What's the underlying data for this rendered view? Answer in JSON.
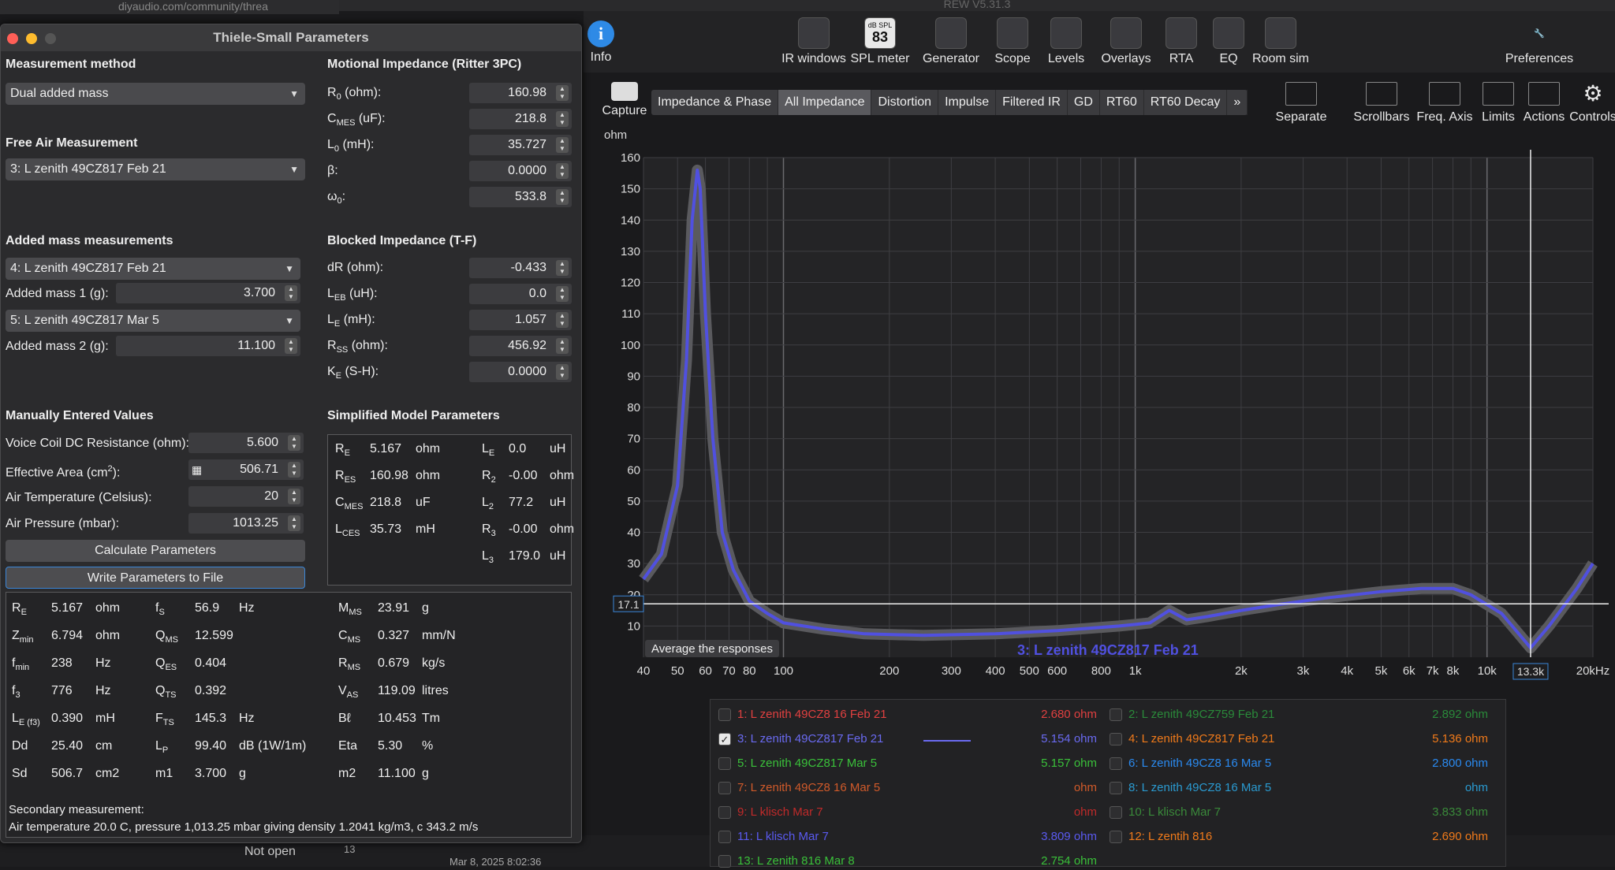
{
  "rew": {
    "app_title": "REW V5.31.3",
    "browser_url": "diyaudio.com/community/threa",
    "toolbar": [
      {
        "label": "IR windows",
        "icon": "ir-windows-icon",
        "x": 1032
      },
      {
        "label": "SPL meter",
        "icon": "spl-meter-icon",
        "x": 1116,
        "badge_top": "dB SPL",
        "badge": "83"
      },
      {
        "label": "Generator",
        "icon": "generator-icon",
        "x": 1206
      },
      {
        "label": "Scope",
        "icon": "scope-icon",
        "x": 1284
      },
      {
        "label": "Levels",
        "icon": "levels-icon",
        "x": 1352
      },
      {
        "label": "Overlays",
        "icon": "overlays-icon",
        "x": 1428
      },
      {
        "label": "RTA",
        "icon": "rta-icon",
        "x": 1498
      },
      {
        "label": "EQ",
        "icon": "eq-icon",
        "x": 1558
      },
      {
        "label": "Room sim",
        "icon": "room-sim-icon",
        "x": 1624
      },
      {
        "label": "Preferences",
        "icon": "preferences-icon",
        "x": 1952
      }
    ],
    "info_label": "Info",
    "capture_label": "Capture",
    "tabs": [
      "Impedance & Phase",
      "All Impedance",
      "Distortion",
      "Impulse",
      "Filtered IR",
      "GD",
      "RT60",
      "RT60 Decay",
      "»"
    ],
    "active_tab": 1,
    "graph_tools": [
      "Separate",
      "Scrollbars",
      "Freq. Axis",
      "Limits",
      "Actions",
      "Controls"
    ],
    "graph": {
      "y_unit": "ohm",
      "cursor_value": "17.1",
      "cursor_freq": "13.3k",
      "overlay_label": "3: L zenith 49CZ817 Feb 21",
      "average_button": "Average the responses"
    }
  },
  "chart_data": {
    "type": "line",
    "ylabel": "ohm",
    "xscale": "log",
    "xlim": [
      40,
      20000
    ],
    "ylim": [
      0,
      160
    ],
    "y_ticks": [
      10,
      20,
      30,
      40,
      50,
      60,
      70,
      80,
      90,
      100,
      110,
      120,
      130,
      140,
      150,
      160
    ],
    "x_ticks": [
      "40",
      "50",
      "60",
      "70",
      "80",
      "100",
      "200",
      "300",
      "400",
      "500",
      "600",
      "800",
      "1k",
      "2k",
      "3k",
      "4k",
      "5k",
      "6k",
      "7k",
      "8k",
      "10k",
      "13.3k",
      "20kHz"
    ],
    "x_tick_values": [
      40,
      50,
      60,
      70,
      80,
      100,
      200,
      300,
      400,
      500,
      600,
      800,
      1000,
      2000,
      3000,
      4000,
      5000,
      6000,
      7000,
      8000,
      10000,
      13300,
      20000
    ],
    "series": [
      {
        "name": "3: L zenith 49CZ817 Feb 21",
        "color": "#5050e0",
        "x": [
          40,
          45,
          50,
          53,
          55,
          56.9,
          58,
          60,
          63,
          67,
          72,
          80,
          90,
          100,
          130,
          170,
          250,
          400,
          600,
          900,
          1000,
          1100,
          1250,
          1400,
          1600,
          2000,
          2600,
          3500,
          5000,
          6500,
          8000,
          9000,
          11000,
          13300,
          15000,
          18000,
          20000
        ],
        "y": [
          25,
          33,
          55,
          95,
          140,
          156,
          150,
          110,
          70,
          40,
          28,
          18,
          14,
          11,
          9,
          7.5,
          7,
          7.5,
          8.5,
          10,
          10.5,
          11,
          15,
          12,
          13,
          15,
          17,
          19,
          21,
          22,
          22,
          20,
          14,
          3,
          10,
          22,
          30
        ]
      }
    ]
  },
  "legend": [
    {
      "label": "1: L zenith 49CZ8 16 Feb 21",
      "value": "2.680 ohm",
      "color": "#e04040",
      "checked": false
    },
    {
      "label": "2: L zenith 49CZ759 Feb 21",
      "value": "2.892 ohm",
      "color": "#2a8a3a",
      "checked": false
    },
    {
      "label": "3: L zenith 49CZ817 Feb 21",
      "value": "5.154 ohm",
      "color": "#6a6af0",
      "checked": true
    },
    {
      "label": "4: L zenith 49CZ817 Feb 21",
      "value": "5.136 ohm",
      "color": "#f07a1a",
      "checked": false
    },
    {
      "label": "5: L zenith 49CZ817 Mar 5",
      "value": "5.157 ohm",
      "color": "#3ac03a",
      "checked": false
    },
    {
      "label": "6: L zenith 49CZ8 16 Mar 5",
      "value": "2.800 ohm",
      "color": "#2a8af0",
      "checked": false
    },
    {
      "label": "7: L zenith 49CZ8 16 Mar 5",
      "value": "ohm",
      "color": "#d05a2a",
      "checked": false
    },
    {
      "label": "8: L zenith 49CZ8 16 Mar 5",
      "value": "ohm",
      "color": "#2a9ad0",
      "checked": false
    },
    {
      "label": "9: L klisch Mar 7",
      "value": "ohm",
      "color": "#c02a2a",
      "checked": false
    },
    {
      "label": "10: L klisch Mar 7",
      "value": "3.833 ohm",
      "color": "#3a8a3a",
      "checked": false
    },
    {
      "label": "11: L klisch Mar 7",
      "value": "3.809 ohm",
      "color": "#5a5af0",
      "checked": false
    },
    {
      "label": "12: L zentih 816",
      "value": "2.690 ohm",
      "color": "#f07a1a",
      "checked": false
    },
    {
      "label": "13: L zenith 816  Mar 8",
      "value": "2.754 ohm",
      "color": "#3ac03a",
      "checked": false
    }
  ],
  "ts": {
    "title": "Thiele-Small Parameters",
    "measurement_method_heading": "Measurement method",
    "measurement_method": "Dual added mass",
    "free_air_heading": "Free Air Measurement",
    "free_air": "3: L zenith 49CZ817 Feb 21",
    "added_mass_heading": "Added mass measurements",
    "added_mass_sel1": "4: L zenith 49CZ817 Feb 21",
    "added_mass1_label": "Added mass 1 (g):",
    "added_mass1": "3.700",
    "added_mass_sel2": "5: L zenith 49CZ817 Mar 5",
    "added_mass2_label": "Added mass 2 (g):",
    "added_mass2": "11.100",
    "manual_heading": "Manually Entered Values",
    "vc_label": "Voice Coil DC Resistance (ohm):",
    "vc": "5.600",
    "area_label": "Effective Area (cm",
    "area": "506.71",
    "temp_label": "Air Temperature (Celsius):",
    "temp": "20",
    "pressure_label": "Air Pressure (mbar):",
    "pressure": "1013.25",
    "calc_button": "Calculate Parameters",
    "write_button": "Write Parameters to File",
    "motional_heading": "Motional Impedance (Ritter 3PC)",
    "motional": [
      {
        "sym": "R",
        "sub": "0",
        "unit": " (ohm):",
        "val": "160.98"
      },
      {
        "sym": "C",
        "sub": "MES",
        "unit": " (uF):",
        "val": "218.8"
      },
      {
        "sym": "L",
        "sub": "0",
        "unit": " (mH):",
        "val": "35.727"
      },
      {
        "sym": "β:",
        "sub": "",
        "unit": "",
        "val": "0.0000"
      },
      {
        "sym": "ω",
        "sub": "0",
        "unit": ":",
        "val": "533.8"
      }
    ],
    "blocked_heading": "Blocked Impedance (T-F)",
    "blocked": [
      {
        "sym": "dR (ohm):",
        "sub": "",
        "unit": "",
        "val": "-0.433"
      },
      {
        "sym": "L",
        "sub": "EB",
        "unit": " (uH):",
        "val": "0.0"
      },
      {
        "sym": "L",
        "sub": "E",
        "unit": " (mH):",
        "val": "1.057"
      },
      {
        "sym": "R",
        "sub": "SS",
        "unit": " (ohm):",
        "val": "456.92"
      },
      {
        "sym": "K",
        "sub": "E",
        "unit": " (S-H):",
        "val": "0.0000"
      }
    ],
    "simplified_heading": "Simplified Model Parameters",
    "simplified": [
      {
        "sym": "R",
        "sub": "E",
        "val": "5.167",
        "unit": "ohm",
        "sym2": "L",
        "sub2": "E",
        "val2": "0.0",
        "unit2": "uH"
      },
      {
        "sym": "R",
        "sub": "ES",
        "val": "160.98",
        "unit": "ohm",
        "sym2": "R",
        "sub2": "2",
        "val2": "-0.00",
        "unit2": "ohm"
      },
      {
        "sym": "C",
        "sub": "MES",
        "val": "218.8",
        "unit": "uF",
        "sym2": "L",
        "sub2": "2",
        "val2": "77.2",
        "unit2": "uH"
      },
      {
        "sym": "L",
        "sub": "CES",
        "val": "35.73",
        "unit": "mH",
        "sym2": "R",
        "sub2": "3",
        "val2": "-0.00",
        "unit2": "ohm"
      },
      {
        "sym": "",
        "sub": "",
        "val": "",
        "unit": "",
        "sym2": "L",
        "sub2": "3",
        "val2": "179.0",
        "unit2": "uH"
      }
    ],
    "results": [
      [
        {
          "sym": "R",
          "sub": "E",
          "val": "5.167",
          "unit": "ohm"
        },
        {
          "sym": "f",
          "sub": "S",
          "val": "56.9",
          "unit": "Hz"
        },
        {
          "sym": "M",
          "sub": "MS",
          "val": "23.91",
          "unit": "g"
        }
      ],
      [
        {
          "sym": "Z",
          "sub": "min",
          "val": "6.794",
          "unit": "ohm"
        },
        {
          "sym": "Q",
          "sub": "MS",
          "val": "12.599",
          "unit": ""
        },
        {
          "sym": "C",
          "sub": "MS",
          "val": "0.327",
          "unit": "mm/N"
        }
      ],
      [
        {
          "sym": "f",
          "sub": "min",
          "val": "238",
          "unit": "Hz"
        },
        {
          "sym": "Q",
          "sub": "ES",
          "val": "0.404",
          "unit": ""
        },
        {
          "sym": "R",
          "sub": "MS",
          "val": "0.679",
          "unit": "kg/s"
        }
      ],
      [
        {
          "sym": "f",
          "sub": "3",
          "val": "776",
          "unit": "Hz"
        },
        {
          "sym": "Q",
          "sub": "TS",
          "val": "0.392",
          "unit": ""
        },
        {
          "sym": "V",
          "sub": "AS",
          "val": "119.09",
          "unit": "litres"
        }
      ],
      [
        {
          "sym": "L",
          "sub": "E (f3)",
          "val": "0.390",
          "unit": "mH"
        },
        {
          "sym": "F",
          "sub": "TS",
          "val": "145.3",
          "unit": "Hz"
        },
        {
          "sym": "Bℓ",
          "sub": "",
          "val": "10.453",
          "unit": "Tm"
        }
      ],
      [
        {
          "sym": "Dd",
          "sub": "",
          "val": "25.40",
          "unit": "cm"
        },
        {
          "sym": "L",
          "sub": "P",
          "val": "99.40",
          "unit": "dB (1W/1m)"
        },
        {
          "sym": "Eta",
          "sub": "",
          "val": "5.30",
          "unit": "%"
        }
      ],
      [
        {
          "sym": "Sd",
          "sub": "",
          "val": "506.7",
          "unit": "cm2"
        },
        {
          "sym": "m1",
          "sub": "",
          "val": "3.700",
          "unit": "g"
        },
        {
          "sym": "m2",
          "sub": "",
          "val": "11.100",
          "unit": "g"
        }
      ]
    ],
    "secondary_label": "Secondary measurement:",
    "air_line": "Air temperature 20.0 C, pressure 1,013.25 mbar giving density 1.2041 kg/m3, c 343.2 m/s"
  },
  "background": {
    "not_open": "Not open",
    "date": "Mar 8, 2025 8:02:36",
    "row_num": "13"
  }
}
